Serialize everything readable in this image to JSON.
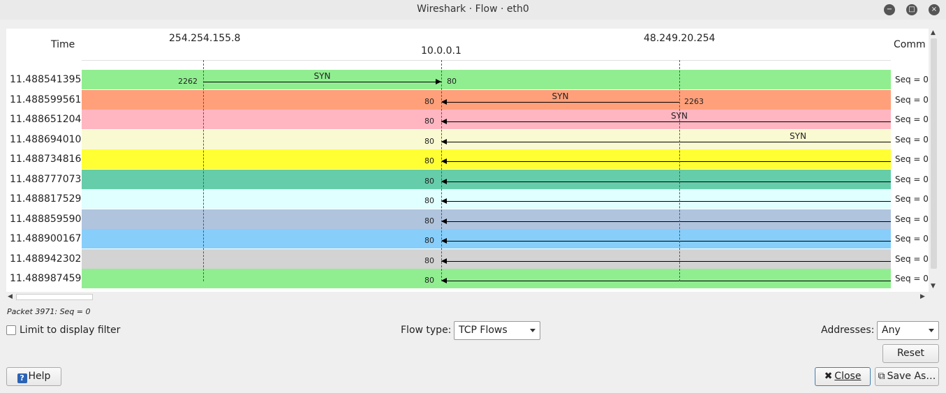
{
  "window": {
    "title": "Wireshark · Flow · eth0",
    "minimize_label": "−",
    "maximize_label": "□",
    "close_label": "×"
  },
  "diagram": {
    "time_header": "Time",
    "comment_header": "Comm",
    "nodes": [
      "254.254.155.8",
      "10.0.0.1",
      "48.249.20.254"
    ],
    "rows": [
      {
        "time": "11.488541395",
        "color": "#90ee90",
        "label": "SYN",
        "src_port": "2262",
        "dst_port": "80",
        "comment": "Seq = 0"
      },
      {
        "time": "11.488599561",
        "color": "#ffa07a",
        "label": "SYN",
        "src_port": "2263",
        "dst_port": "80",
        "comment": "Seq = 0"
      },
      {
        "time": "11.488651204",
        "color": "#ffb6c1",
        "label": "SYN",
        "src_port": "",
        "dst_port": "80",
        "comment": "Seq = 0"
      },
      {
        "time": "11.488694010",
        "color": "#fafad2",
        "label": "SYN",
        "src_port": "",
        "dst_port": "80",
        "comment": "Seq = 0"
      },
      {
        "time": "11.488734816",
        "color": "#ffff33",
        "label": "",
        "src_port": "",
        "dst_port": "80",
        "comment": "Seq = 0"
      },
      {
        "time": "11.488777073",
        "color": "#66cdaa",
        "label": "",
        "src_port": "",
        "dst_port": "80",
        "comment": "Seq = 0"
      },
      {
        "time": "11.488817529",
        "color": "#e0ffff",
        "label": "",
        "src_port": "",
        "dst_port": "80",
        "comment": "Seq = 0"
      },
      {
        "time": "11.488859590",
        "color": "#b0c4de",
        "label": "",
        "src_port": "",
        "dst_port": "80",
        "comment": "Seq = 0"
      },
      {
        "time": "11.488900167",
        "color": "#87cefa",
        "label": "",
        "src_port": "",
        "dst_port": "80",
        "comment": "Seq = 0"
      },
      {
        "time": "11.488942302",
        "color": "#d3d3d3",
        "label": "",
        "src_port": "",
        "dst_port": "80",
        "comment": "Seq = 0"
      },
      {
        "time": "11.488987459",
        "color": "#90ee90",
        "label": "",
        "src_port": "",
        "dst_port": "80",
        "comment": "Seq = 0"
      }
    ]
  },
  "status_text": "Packet 3971: Seq = 0",
  "controls": {
    "limit_label": "Limit to display filter",
    "limit_checked": false,
    "flow_type_label": "Flow type:",
    "flow_type_value": "TCP Flows",
    "addresses_label": "Addresses:",
    "addresses_value": "Any"
  },
  "buttons": {
    "reset": "Reset",
    "help_icon": "?",
    "help": "Help",
    "close_icon": "✖",
    "close": "Close",
    "save_icon": "⧉",
    "save": "Save As…"
  }
}
